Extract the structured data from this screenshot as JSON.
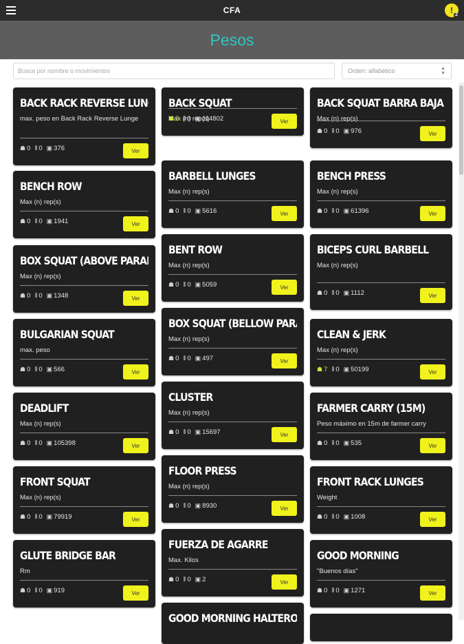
{
  "app": {
    "title": "CFA",
    "notification_count": "2"
  },
  "page": {
    "title": "Pesos"
  },
  "search": {
    "placeholder": "Busca por nombre o movimientos"
  },
  "order": {
    "label": "Orden: alfabético"
  },
  "button_label": "Ver",
  "colors": {
    "topbar": "#2b2b2b",
    "header": "#5d5d5d",
    "title_accent": "#2fc6c4",
    "card_bg": "#202020",
    "button_yellow": "#f0f21c",
    "highlight": "#d6e23a"
  },
  "columns": [
    [
      {
        "title": "BACK RACK REVERSE LUNGE",
        "desc": "max. peso en Back Rack Reverse Lunge",
        "a": "0",
        "b": "0",
        "c": "376",
        "hl": false
      },
      {
        "title": "BENCH ROW",
        "desc": "Max (n) rep(s)",
        "a": "0",
        "b": "0",
        "c": "1941",
        "hl": false
      },
      {
        "title": "BOX SQUAT (ABOVE PARALLEL)",
        "desc": "Max (n) rep(s)",
        "a": "0",
        "b": "0",
        "c": "1348",
        "hl": false
      },
      {
        "title": "BULGARIAN SQUAT",
        "desc": "max. peso",
        "a": "0",
        "b": "0",
        "c": "566",
        "hl": false
      },
      {
        "title": "DEADLIFT",
        "desc": "Max (n) rep(s)",
        "a": "0",
        "b": "0",
        "c": "105398",
        "hl": false
      },
      {
        "title": "FRONT SQUAT",
        "desc": "Max (n) rep(s)",
        "a": "0",
        "b": "0",
        "c": "79919",
        "hl": false
      },
      {
        "title": "GLUTE BRIDGE BAR",
        "desc": "Rm",
        "a": "0",
        "b": "0",
        "c": "919",
        "hl": false
      }
    ],
    [
      {
        "title": "BACK SQUAT",
        "desc": "Max (n) rep(s)",
        "a": "2",
        "b": "0",
        "c": "114802",
        "hl": true
      },
      {
        "title": "BARBELL LUNGES",
        "desc": "Max (n) rep(s)",
        "a": "0",
        "b": "0",
        "c": "5616",
        "hl": false
      },
      {
        "title": "BENT ROW",
        "desc": "Max (n) rep(s)",
        "a": "0",
        "b": "0",
        "c": "5059",
        "hl": false
      },
      {
        "title": "BOX SQUAT (BELLOW PARALLEL)",
        "desc": "Max (n) rep(s)",
        "a": "0",
        "b": "0",
        "c": "497",
        "hl": false
      },
      {
        "title": "CLUSTER",
        "desc": "Max (n) rep(s)",
        "a": "0",
        "b": "0",
        "c": "15697",
        "hl": false
      },
      {
        "title": "FLOOR PRESS",
        "desc": "Max (n) rep(s)",
        "a": "0",
        "b": "0",
        "c": "8930",
        "hl": false
      },
      {
        "title": "FUERZA DE AGARRE",
        "desc": "Max. Kilos",
        "a": "0",
        "b": "0",
        "c": "2",
        "hl": false
      },
      {
        "title": "GOOD MORNING HALTEROFILIA",
        "desc": "",
        "a": "",
        "b": "",
        "c": "",
        "hl": false
      }
    ],
    [
      {
        "title": "BACK SQUAT BARRA BAJA",
        "desc": "Max (n) rep(s)",
        "a": "0",
        "b": "0",
        "c": "976",
        "hl": false
      },
      {
        "title": "BENCH PRESS",
        "desc": "Max (n) rep(s)",
        "a": "0",
        "b": "0",
        "c": "61396",
        "hl": false
      },
      {
        "title": "BICEPS CURL BARBELL",
        "desc": "Max (n) rep(s)",
        "a": "0",
        "b": "0",
        "c": "1112",
        "hl": false
      },
      {
        "title": "CLEAN & JERK",
        "desc": "Max (n) rep(s)",
        "a": "7",
        "b": "0",
        "c": "50199",
        "hl": true
      },
      {
        "title": "FARMER CARRY (15M)",
        "desc": "Peso máximo en 15m de farmer carry",
        "a": "0",
        "b": "0",
        "c": "535",
        "hl": false
      },
      {
        "title": "FRONT RACK LUNGES",
        "desc": "Weight",
        "a": "0",
        "b": "0",
        "c": "1008",
        "hl": false
      },
      {
        "title": "GOOD MORNING",
        "desc": "\"Buenos días\"",
        "a": "0",
        "b": "0",
        "c": "1271",
        "hl": false
      },
      {
        "title": "",
        "desc": "",
        "a": "",
        "b": "",
        "c": "",
        "hl": false
      }
    ]
  ]
}
